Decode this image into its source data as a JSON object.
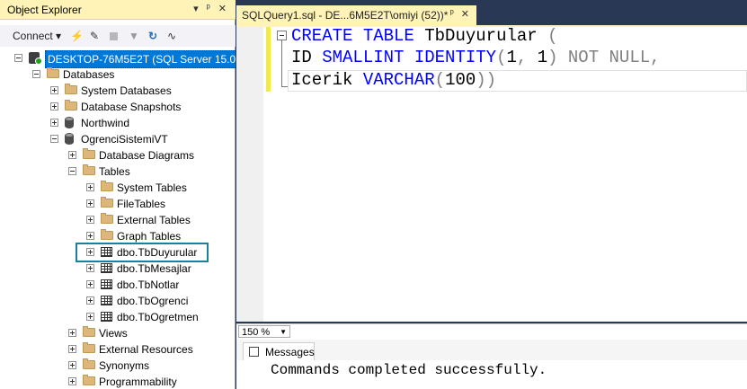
{
  "object_explorer": {
    "title": "Object Explorer",
    "title_controls": [
      "▾",
      "ᵖ",
      "✕"
    ],
    "toolbar": {
      "connect_label": "Connect ▾"
    },
    "tree": [
      {
        "name": "tree-server",
        "label": "DESKTOP-76M5E2T (SQL Server 15.0.20",
        "icon": "server",
        "expander": "minus"
      },
      {
        "name": "tree-databases",
        "label": "Databases",
        "icon": "folder",
        "expander": "minus"
      },
      {
        "name": "tree-system-databases",
        "label": "System Databases",
        "icon": "folder",
        "expander": "plus"
      },
      {
        "name": "tree-database-snapshots",
        "label": "Database Snapshots",
        "icon": "folder",
        "expander": "plus"
      },
      {
        "name": "tree-northwind",
        "label": "Northwind",
        "icon": "database",
        "expander": "plus"
      },
      {
        "name": "tree-ogrencisistemivt",
        "label": "OgrenciSistemiVT",
        "icon": "database",
        "expander": "minus"
      },
      {
        "name": "tree-database-diagrams",
        "label": "Database Diagrams",
        "icon": "folder",
        "expander": "plus"
      },
      {
        "name": "tree-tables",
        "label": "Tables",
        "icon": "folder",
        "expander": "minus"
      },
      {
        "name": "tree-system-tables",
        "label": "System Tables",
        "icon": "folder",
        "expander": "plus"
      },
      {
        "name": "tree-filetables",
        "label": "FileTables",
        "icon": "folder",
        "expander": "plus"
      },
      {
        "name": "tree-external-tables",
        "label": "External Tables",
        "icon": "folder",
        "expander": "plus"
      },
      {
        "name": "tree-graph-tables",
        "label": "Graph Tables",
        "icon": "folder",
        "expander": "plus"
      },
      {
        "name": "tree-tbduyurular",
        "label": "dbo.TbDuyurular",
        "icon": "table",
        "expander": "plus"
      },
      {
        "name": "tree-tbmesajlar",
        "label": "dbo.TbMesajlar",
        "icon": "table",
        "expander": "plus"
      },
      {
        "name": "tree-tbnotlar",
        "label": "dbo.TbNotlar",
        "icon": "table",
        "expander": "plus"
      },
      {
        "name": "tree-tbogrenci",
        "label": "dbo.TbOgrenci",
        "icon": "table",
        "expander": "plus"
      },
      {
        "name": "tree-tbogretmen",
        "label": "dbo.TbOgretmen",
        "icon": "table",
        "expander": "plus"
      },
      {
        "name": "tree-views",
        "label": "Views",
        "icon": "folder",
        "expander": "plus"
      },
      {
        "name": "tree-external-resources",
        "label": "External Resources",
        "icon": "folder",
        "expander": "plus"
      },
      {
        "name": "tree-synonyms",
        "label": "Synonyms",
        "icon": "folder",
        "expander": "plus"
      },
      {
        "name": "tree-programmability",
        "label": "Programmability",
        "icon": "folder",
        "expander": "plus"
      }
    ]
  },
  "editor": {
    "tab_title": "SQLQuery1.sql - DE...6M5E2T\\omiyi (52))*",
    "tab_controls": [
      "ᵖ",
      "✕"
    ],
    "code": {
      "line1": {
        "kw1": "CREATE",
        "kw2": "TABLE",
        "ident": "TbDuyurular",
        "paren": "("
      },
      "line2": {
        "ident": "ID",
        "type": "SMALLINT",
        "identity": "IDENTITY",
        "args_open": "(",
        "n1": "1",
        "comma": ",",
        "n2": "1",
        "args_close": ")",
        "notnull": "NOT NULL,"
      },
      "line3": {
        "ident": "Icerik",
        "type": "VARCHAR",
        "open": "(",
        "len": "100",
        "close": "))"
      }
    },
    "zoom_level": "150 %",
    "results_tab": "Messages",
    "message": "Commands completed successfully."
  },
  "colors": {
    "keyword": "#0000ff",
    "gray": "#808080",
    "accent": "#fff3b8",
    "highlight_box": "#1a7fa3"
  }
}
